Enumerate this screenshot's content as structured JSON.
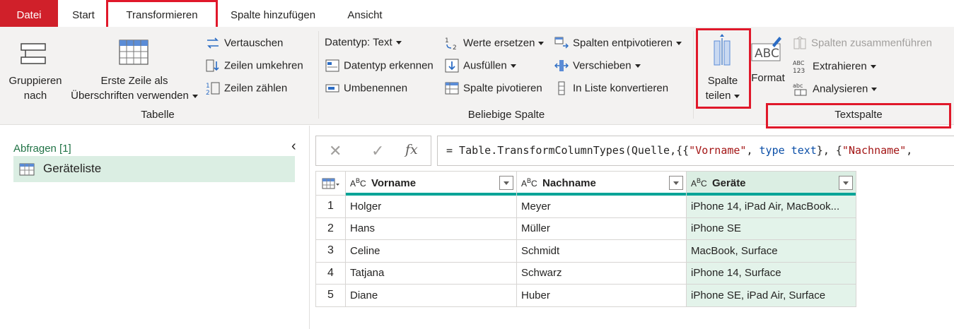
{
  "tabs": {
    "file": "Datei",
    "start": "Start",
    "transform": "Transformieren",
    "add_column": "Spalte hinzufügen",
    "view": "Ansicht"
  },
  "ribbon": {
    "group_by": [
      "Gruppieren",
      "nach"
    ],
    "first_row": [
      "Erste Zeile als",
      "Überschriften verwenden"
    ],
    "swap": "Vertauschen",
    "reverse_rows": "Zeilen umkehren",
    "count_rows": "Zeilen zählen",
    "group_table": "Tabelle",
    "data_type": "Datentyp: Text",
    "detect_type": "Datentyp erkennen",
    "rename": "Umbenennen",
    "replace_values": "Werte ersetzen",
    "fill": "Ausfüllen",
    "pivot_column": "Spalte pivotieren",
    "unpivot": "Spalten entpivotieren",
    "move": "Verschieben",
    "to_list": "In Liste konvertieren",
    "group_any_column": "Beliebige Spalte",
    "split_column": [
      "Spalte",
      "teilen"
    ],
    "format": "Format",
    "merge_columns": "Spalten zusammenführen",
    "extract": "Extrahieren",
    "parse": "Analysieren",
    "group_text_column": "Textspalte"
  },
  "queries": {
    "header": "Abfragen [1]",
    "items": [
      "Geräteliste"
    ]
  },
  "formula": {
    "prefix": "= Table.TransformColumnTypes(Quelle,{{",
    "s1": "\"Vorname\"",
    "sep1": ", ",
    "kw1": "type text",
    "mid": "}, {",
    "s2": "\"Nachname\"",
    "tail": ","
  },
  "grid": {
    "columns": [
      {
        "type": "ABC",
        "name": "Vorname"
      },
      {
        "type": "ABC",
        "name": "Nachname"
      },
      {
        "type": "ABC",
        "name": "Geräte"
      }
    ],
    "rows": [
      {
        "n": "1",
        "cells": [
          "Holger",
          "Meyer",
          "iPhone 14, iPad Air, MacBook..."
        ]
      },
      {
        "n": "2",
        "cells": [
          "Hans",
          "Müller",
          "iPhone SE"
        ]
      },
      {
        "n": "3",
        "cells": [
          "Celine",
          "Schmidt",
          "MacBook, Surface"
        ]
      },
      {
        "n": "4",
        "cells": [
          "Tatjana",
          "Schwarz",
          "iPhone 14, Surface"
        ]
      },
      {
        "n": "5",
        "cells": [
          "Diane",
          "Huber",
          "iPhone SE, iPad Air, Surface"
        ]
      }
    ]
  },
  "colors": {
    "file_tab": "#d0202a",
    "highlight_box": "#e0182a",
    "selected_column": "#e3f3ea",
    "quality_bar": "#00a497"
  }
}
